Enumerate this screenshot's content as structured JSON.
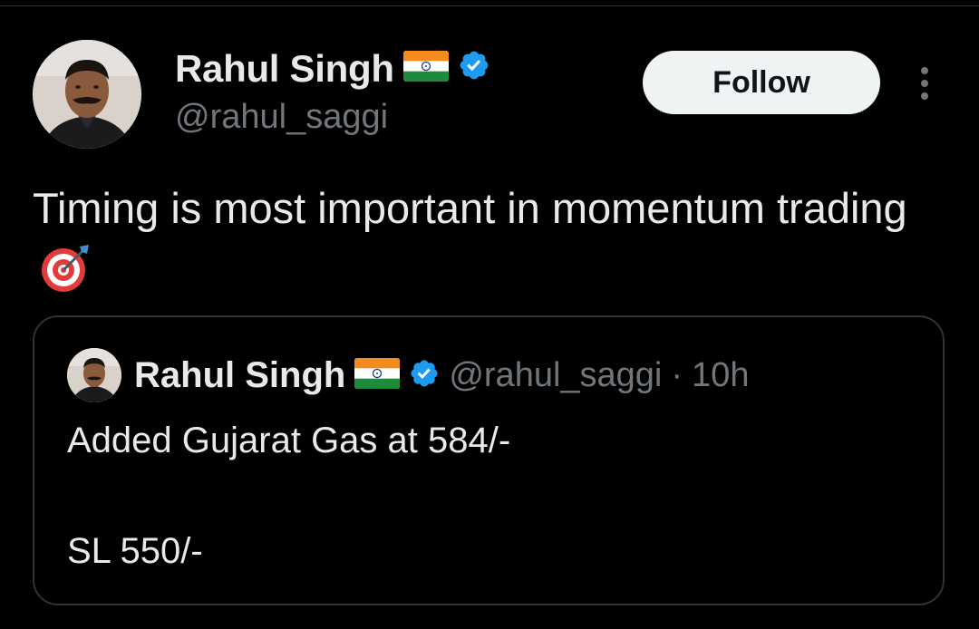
{
  "author": {
    "display_name": "Rahul Singh",
    "handle": "@rahul_saggi",
    "flag_icon": "india-flag-icon",
    "verified_icon": "verified-badge-icon",
    "verified_color": "#1d9bf0"
  },
  "follow_label": "Follow",
  "more_icon": "more-vertical-icon",
  "tweet": {
    "text": "Timing is most important in momentum trading",
    "emoji_icon": "direct-hit-target-icon"
  },
  "quoted": {
    "display_name": "Rahul Singh",
    "handle": "@rahul_saggi",
    "separator": "·",
    "time": "10h",
    "lines": [
      "Added Gujarat Gas at 584/-",
      "SL 550/-"
    ]
  },
  "colors": {
    "background": "#000000",
    "primary_text": "#e7e9ea",
    "secondary_text": "#71767b",
    "border": "#2f3336",
    "button_bg": "#eff3f4"
  }
}
